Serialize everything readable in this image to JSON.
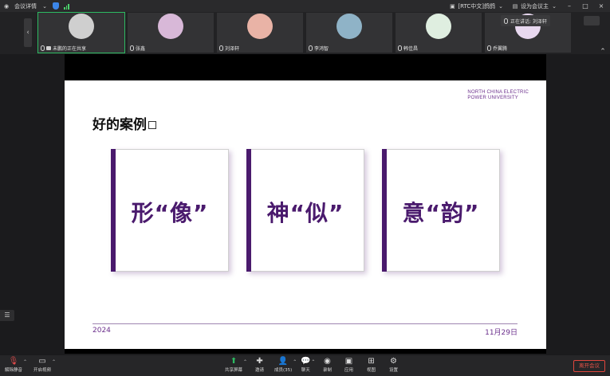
{
  "topbar": {
    "meeting_info_label": "会议详情",
    "user_label": "[RTC中文]鸽鸽",
    "host_label": "设为会议主",
    "window_buttons": {
      "minimize": "–",
      "restore": "□",
      "close": "×"
    }
  },
  "participants": {
    "prev_arrow": "‹",
    "tiles": [
      {
        "name": "未鹏的正在共享",
        "avatar_color": "#cfcfcf",
        "active": true
      },
      {
        "name": "张鑫",
        "avatar_color": "#d8b8d8"
      },
      {
        "name": "刘泽轩",
        "avatar_color": "#e9b3a6"
      },
      {
        "name": "李鸿智",
        "avatar_color": "#8fb3c7"
      },
      {
        "name": "韩佳昌",
        "avatar_color": "#dfeee0"
      },
      {
        "name": "乔翼腾",
        "avatar_color": "#e8d8ef"
      }
    ],
    "floating_name": "正在讲话: 刘泽轩",
    "collapse_icon": "⌃"
  },
  "slide": {
    "university_line1": "NORTH CHINA ELECTRIC",
    "university_line2": "POWER UNIVERSITY",
    "title": "好的案例",
    "cards": [
      {
        "text": "形“像”"
      },
      {
        "text": "神“似”"
      },
      {
        "text": "意“韵”"
      }
    ],
    "year": "2024",
    "date": "11月29日"
  },
  "toolbar": {
    "mic_label": "解除静音",
    "camera_label": "开启视频",
    "items": [
      {
        "label": "共享屏幕",
        "icon": "share-screen-icon"
      },
      {
        "label": "邀请",
        "icon": "invite-icon"
      },
      {
        "label": "成员(35)",
        "icon": "members-icon"
      },
      {
        "label": "聊天",
        "icon": "chat-icon"
      },
      {
        "label": "录制",
        "icon": "record-icon"
      },
      {
        "label": "应用",
        "icon": "apps-icon"
      },
      {
        "label": "视图",
        "icon": "view-icon"
      },
      {
        "label": "设置",
        "icon": "settings-icon"
      }
    ],
    "leave_label": "离开会议"
  },
  "colors": {
    "accent_purple": "#4a1a6d",
    "share_green": "#2dbb62",
    "leave_red": "#e0463d"
  }
}
